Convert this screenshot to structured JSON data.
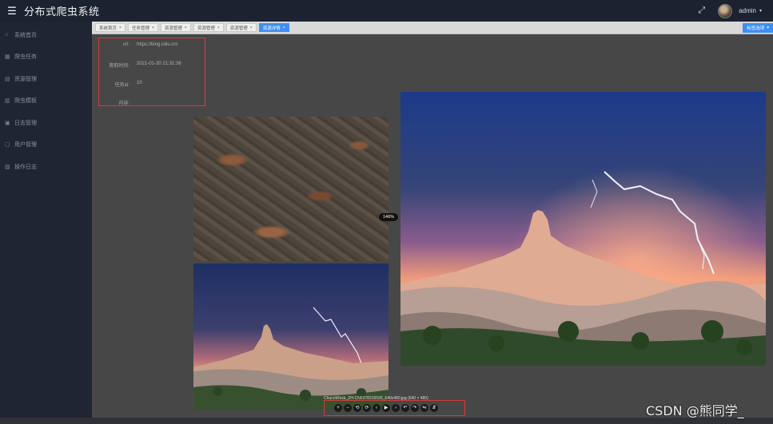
{
  "header": {
    "menu_icon": "☰",
    "title": "分布式爬虫系统",
    "fullscreen_icon": "⤢",
    "user_name": "admin",
    "caret": "▾"
  },
  "sidebar": {
    "items": [
      {
        "icon": "⌂",
        "label": "系统首页"
      },
      {
        "icon": "▦",
        "label": "爬虫任务"
      },
      {
        "icon": "▤",
        "label": "资源管理"
      },
      {
        "icon": "▥",
        "label": "爬虫模板"
      },
      {
        "icon": "▣",
        "label": "日志管理"
      },
      {
        "icon": "▢",
        "label": "用户管理"
      },
      {
        "icon": "▧",
        "label": "操作日志"
      }
    ]
  },
  "tabs": {
    "items": [
      {
        "label": "系统首页",
        "close": "×"
      },
      {
        "label": "任务管理",
        "close": "×"
      },
      {
        "label": "资源管理",
        "close": "×"
      },
      {
        "label": "资源管理",
        "close": "×"
      },
      {
        "label": "资源管理",
        "close": "×"
      },
      {
        "label": "资源详情",
        "close": "×"
      }
    ],
    "ops_label": "标签选项",
    "ops_caret": "▾"
  },
  "detail": {
    "url_label": "url:",
    "url_value": "https://bing.ioliu.cn/",
    "time_label": "爬取时间:",
    "time_value": "2021-01-30 21:31:36",
    "task_label": "任务id:",
    "task_value": "10",
    "content_label": "内容:"
  },
  "viewer": {
    "zoom": "146%",
    "caption": "ChurchRock_ZH-CN6378315599_640x480.jpg (640 × 480)",
    "toolbar": [
      "+",
      "−",
      "⟲",
      "⟳",
      "‹",
      "▶",
      "›",
      "↶",
      "↷",
      "⇋",
      "⇵"
    ]
  },
  "watermark": "CSDN @熊同学_",
  "colors": {
    "highlight_border": "#d23c3c",
    "active_tab": "#3e8ef7",
    "sidebar_bg": "#1f2533"
  }
}
